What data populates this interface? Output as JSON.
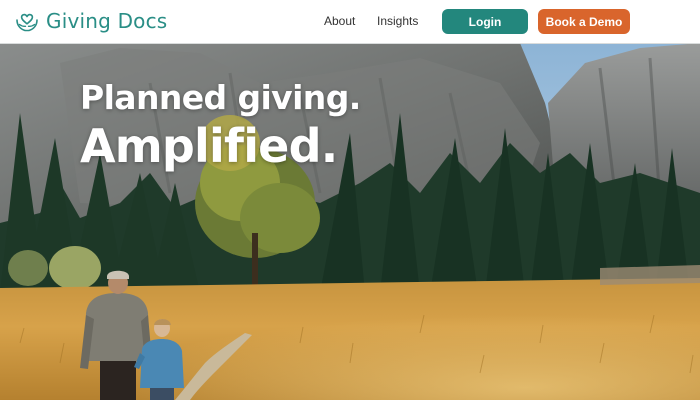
{
  "brand": {
    "name": "Giving Docs",
    "icon": "hands-heart-icon"
  },
  "nav": {
    "about": "About",
    "insights": "Insights"
  },
  "buttons": {
    "login": "Login",
    "demo": "Book a Demo"
  },
  "hero": {
    "line1": "Planned giving.",
    "line2": "Amplified."
  },
  "colors": {
    "brand_teal": "#2a8e86",
    "login_bg": "#23877d",
    "demo_bg": "#d9652c",
    "hero_text": "#ffffff"
  }
}
